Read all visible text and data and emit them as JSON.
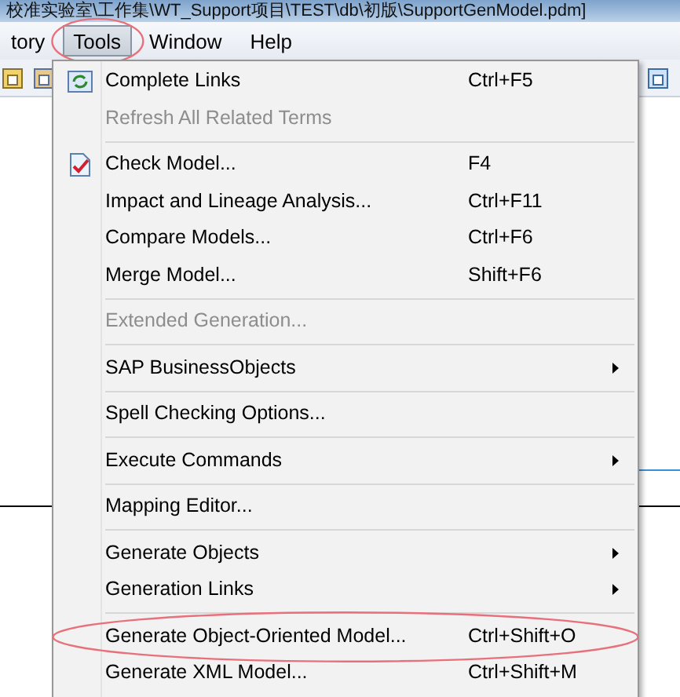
{
  "window": {
    "title": "校准实验室\\工作集\\WT_Support项目\\TEST\\db\\初版\\SupportGenModel.pdm]"
  },
  "menubar": [
    {
      "label": "tory",
      "selected": false,
      "circled": false
    },
    {
      "label": "Tools",
      "selected": true,
      "circled": true
    },
    {
      "label": "Window",
      "selected": false,
      "circled": false
    },
    {
      "label": "Help",
      "selected": false,
      "circled": false
    }
  ],
  "menu": [
    {
      "kind": "refresh",
      "label": "Complete Links",
      "shortcut": "Ctrl+F5",
      "disabled": false,
      "submenu": false,
      "circled": false
    },
    {
      "kind": "item",
      "label": "Refresh All Related Terms",
      "disabled": true,
      "submenu": false,
      "circled": false
    },
    {
      "kind": "separator"
    },
    {
      "kind": "check",
      "label": "Check Model...",
      "shortcut": "F4",
      "disabled": false,
      "submenu": false,
      "circled": false
    },
    {
      "kind": "item",
      "label": "Impact and Lineage Analysis...",
      "shortcut": "Ctrl+F11",
      "disabled": false,
      "submenu": false,
      "circled": false
    },
    {
      "kind": "item",
      "label": "Compare Models...",
      "shortcut": "Ctrl+F6",
      "disabled": false,
      "submenu": false,
      "circled": false
    },
    {
      "kind": "item",
      "label": "Merge Model...",
      "shortcut": "Shift+F6",
      "disabled": false,
      "submenu": false,
      "circled": false
    },
    {
      "kind": "separator"
    },
    {
      "kind": "item",
      "label": "Extended Generation...",
      "disabled": true,
      "submenu": false,
      "circled": false
    },
    {
      "kind": "separator"
    },
    {
      "kind": "item",
      "label": "SAP BusinessObjects",
      "disabled": false,
      "submenu": true,
      "circled": false
    },
    {
      "kind": "separator"
    },
    {
      "kind": "item",
      "label": "Spell Checking Options...",
      "disabled": false,
      "submenu": false,
      "circled": false
    },
    {
      "kind": "separator"
    },
    {
      "kind": "item",
      "label": "Execute Commands",
      "disabled": false,
      "submenu": true,
      "circled": false
    },
    {
      "kind": "separator"
    },
    {
      "kind": "item",
      "label": "Mapping Editor...",
      "disabled": false,
      "submenu": false,
      "circled": false
    },
    {
      "kind": "separator"
    },
    {
      "kind": "item",
      "label": "Generate Objects",
      "disabled": false,
      "submenu": true,
      "circled": false
    },
    {
      "kind": "item",
      "label": "Generation Links",
      "disabled": false,
      "submenu": true,
      "circled": false
    },
    {
      "kind": "separator"
    },
    {
      "kind": "item",
      "label": "Generate Object-Oriented Model...",
      "shortcut": "Ctrl+Shift+O",
      "disabled": false,
      "submenu": false,
      "circled": true
    },
    {
      "kind": "item",
      "label": "Generate XML Model...",
      "shortcut": "Ctrl+Shift+M",
      "disabled": false,
      "submenu": false,
      "circled": false
    }
  ]
}
